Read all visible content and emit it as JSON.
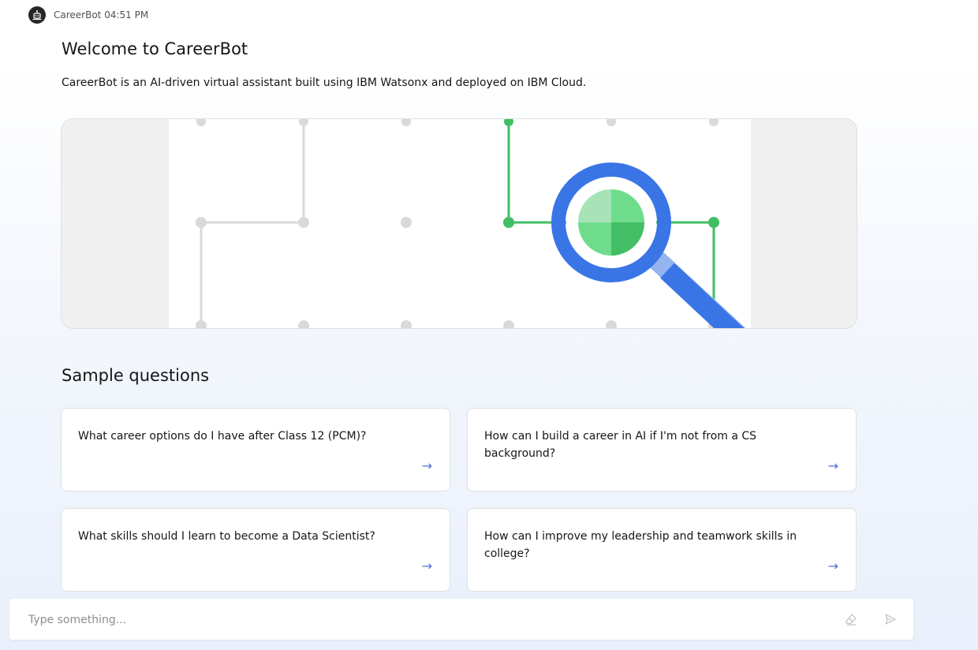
{
  "bot": {
    "name_time": "CareerBot 04:51 PM",
    "avatar_icon": "robot-icon"
  },
  "welcome": {
    "title": "Welcome to CareerBot",
    "description": "CareerBot is an AI-driven virtual assistant built using IBM Watsonx and deployed on IBM Cloud."
  },
  "hero": {
    "illustration": "magnifying-glass-network-icon"
  },
  "samples": {
    "title": "Sample questions",
    "questions": [
      "What career options do I have after Class 12 (PCM)?",
      "How can I build a career in AI if I'm not from a CS background?",
      "What skills should I learn to become a Data Scientist?",
      "How can I improve my leadership and teamwork skills in college?"
    ],
    "arrow": "→"
  },
  "composer": {
    "placeholder": "Type something...",
    "clear_icon": "eraser-icon",
    "send_icon": "send-icon"
  },
  "colors": {
    "accent_blue": "#4a6fd6",
    "green": "#42be65",
    "magnifier_blue": "#3a75e6"
  }
}
